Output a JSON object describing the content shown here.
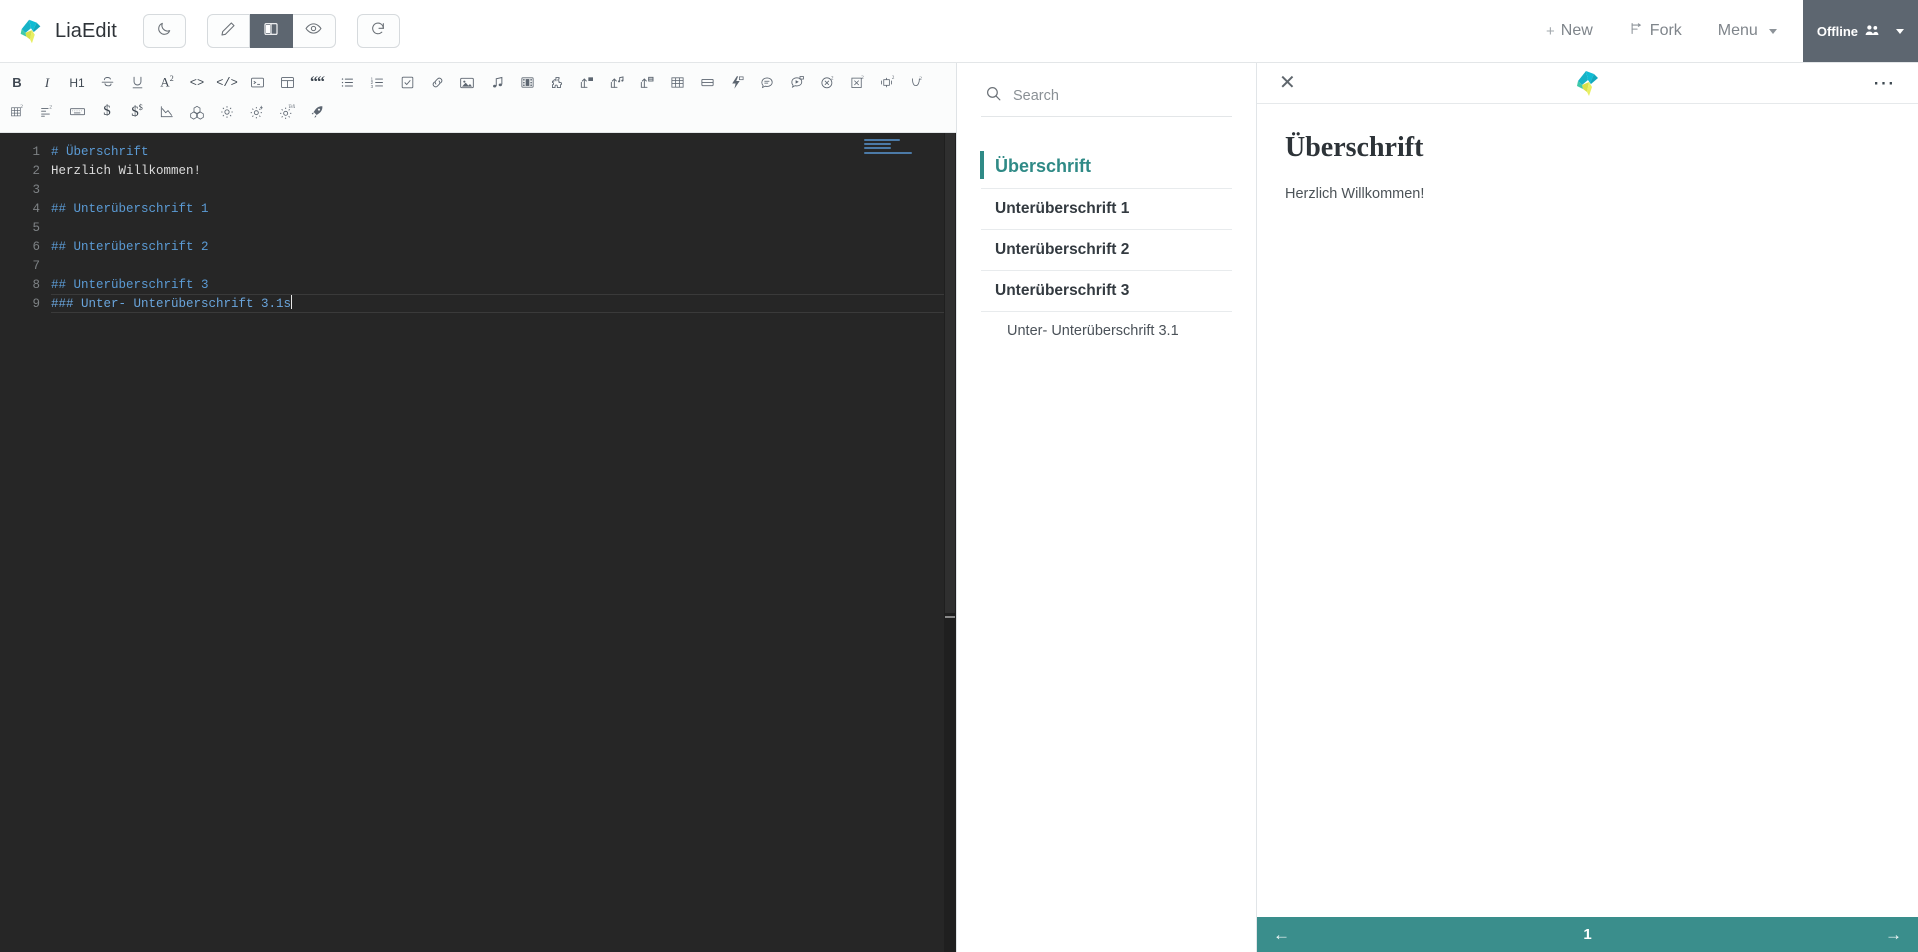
{
  "app": {
    "title": "LiaEdit",
    "logo_icon": "liascript-bird-logo"
  },
  "topbar": {
    "mode_buttons": [
      {
        "name": "dark-mode-toggle",
        "icon": "moon-icon",
        "active": false
      },
      {
        "name": "edit-mode",
        "icon": "pencil-icon",
        "active": false
      },
      {
        "name": "split-mode",
        "icon": "split-view-icon",
        "active": true
      },
      {
        "name": "preview-mode",
        "icon": "eye-icon",
        "active": false
      },
      {
        "name": "reload",
        "icon": "refresh-icon",
        "active": false
      }
    ],
    "new_label": "New",
    "new_icon": "plus-icon",
    "fork_label": "Fork",
    "fork_icon": "fork-icon",
    "menu_label": "Menu",
    "offline_label": "Offline",
    "offline_icon": "users-icon",
    "accent_color": "#5d6670"
  },
  "toolbar": {
    "row1": [
      {
        "name": "bold-button",
        "label": "B",
        "icon": "bold-icon"
      },
      {
        "name": "italic-button",
        "label": "I",
        "icon": "italic-icon"
      },
      {
        "name": "heading-button",
        "label": "H1",
        "icon": "heading-icon"
      },
      {
        "name": "strikethrough-button",
        "label": "S",
        "icon": "strikethrough-icon"
      },
      {
        "name": "underline-button",
        "label": "U",
        "icon": "underline-icon"
      },
      {
        "name": "superscript-button",
        "label": "A2",
        "icon": "superscript-icon"
      },
      {
        "name": "inline-code-button",
        "label": "<>",
        "icon": "inline-code-icon"
      },
      {
        "name": "code-block-button",
        "label": "</>",
        "icon": "code-block-icon"
      },
      {
        "name": "terminal-button",
        "label": "",
        "icon": "terminal-icon"
      },
      {
        "name": "quiz-button",
        "label": "",
        "icon": "quiz-icon"
      },
      {
        "name": "blockquote-button",
        "label": "",
        "icon": "quote-icon"
      },
      {
        "name": "bullet-list-button",
        "label": "",
        "icon": "bullet-list-icon"
      },
      {
        "name": "ordered-list-button",
        "label": "",
        "icon": "ordered-list-icon"
      },
      {
        "name": "task-list-button",
        "label": "",
        "icon": "checkbox-icon"
      },
      {
        "name": "link-button",
        "label": "",
        "icon": "link-icon"
      },
      {
        "name": "image-button",
        "label": "",
        "icon": "image-icon"
      },
      {
        "name": "audio-button",
        "label": "",
        "icon": "music-note-icon"
      },
      {
        "name": "video-button",
        "label": "",
        "icon": "film-icon"
      },
      {
        "name": "embed-button",
        "label": "",
        "icon": "puzzle-icon"
      },
      {
        "name": "upload-image-button",
        "label": "",
        "icon": "upload-image-icon"
      },
      {
        "name": "upload-audio-button",
        "label": "",
        "icon": "upload-audio-icon"
      },
      {
        "name": "upload-file-button",
        "label": "",
        "icon": "upload-file-icon"
      },
      {
        "name": "table-button",
        "label": "",
        "icon": "table-icon"
      },
      {
        "name": "horizontal-rule-button",
        "label": "",
        "icon": "hrule-icon"
      },
      {
        "name": "effect-button",
        "label": "",
        "icon": "lightning-icon"
      },
      {
        "name": "comment-button",
        "label": "",
        "icon": "speech-bubble-icon"
      },
      {
        "name": "animation-button",
        "label": "",
        "icon": "play-bubble-icon"
      },
      {
        "name": "circle-x-button",
        "label": "",
        "icon": "circle-x-icon"
      },
      {
        "name": "square-x-button",
        "label": "",
        "icon": "square-x-icon"
      },
      {
        "name": "gallery-button",
        "label": "",
        "icon": "gallery-icon"
      },
      {
        "name": "curve-button",
        "label": "",
        "icon": "curve-icon"
      }
    ],
    "row2": [
      {
        "name": "grid-quiz-button",
        "label": "",
        "icon": "grid-quiz-icon"
      },
      {
        "name": "survey-button",
        "label": "",
        "icon": "survey-icon"
      },
      {
        "name": "input-field-button",
        "label": "",
        "icon": "keyboard-icon"
      },
      {
        "name": "formula-button",
        "label": "$",
        "icon": "dollar-icon"
      },
      {
        "name": "formula-block-button",
        "label": "$$",
        "icon": "dollar-super-icon"
      },
      {
        "name": "chart-button",
        "label": "",
        "icon": "chart-icon"
      },
      {
        "name": "molecule-button",
        "label": "",
        "icon": "molecule-icon"
      },
      {
        "name": "settings-button",
        "label": "",
        "icon": "gear-icon"
      },
      {
        "name": "settings-effect-button",
        "label": "",
        "icon": "gear-lightning-icon"
      },
      {
        "name": "settings-tex-button",
        "label": "",
        "icon": "gear-tex-icon"
      },
      {
        "name": "rocket-button",
        "label": "",
        "icon": "rocket-icon"
      }
    ]
  },
  "editor": {
    "lines": [
      {
        "num": "1",
        "text": "# Überschrift",
        "kind": "heading"
      },
      {
        "num": "2",
        "text": "Herzlich Willkommen!",
        "kind": "text"
      },
      {
        "num": "3",
        "text": "",
        "kind": "text"
      },
      {
        "num": "4",
        "text": "## Unterüberschrift 1",
        "kind": "heading"
      },
      {
        "num": "5",
        "text": "",
        "kind": "text"
      },
      {
        "num": "6",
        "text": "## Unterüberschrift 2",
        "kind": "heading"
      },
      {
        "num": "7",
        "text": "",
        "kind": "text"
      },
      {
        "num": "8",
        "text": "## Unterüberschrift 3",
        "kind": "heading"
      },
      {
        "num": "9",
        "text": "### Unter- Unterüberschrift 3.1s",
        "kind": "heading-active"
      }
    ]
  },
  "toc": {
    "search_placeholder": "Search",
    "search_value": "",
    "search_icon": "search-icon",
    "items": [
      {
        "label": "Überschrift",
        "level": 1
      },
      {
        "label": "Unterüberschrift 1",
        "level": 2
      },
      {
        "label": "Unterüberschrift 2",
        "level": 2
      },
      {
        "label": "Unterüberschrift 3",
        "level": 2
      },
      {
        "label": "Unter- Unterüberschrift 3.1",
        "level": 3
      }
    ],
    "accent_color": "#2f8a86"
  },
  "preview": {
    "close_icon": "close-icon",
    "logo_icon": "liascript-bird-logo",
    "menu_icon": "more-options-icon",
    "heading": "Überschrift",
    "paragraph": "Herzlich Willkommen!",
    "nav": {
      "prev_icon": "arrow-left-icon",
      "prev_label": "←",
      "page": "1",
      "next_icon": "arrow-right-icon",
      "next_label": "→",
      "bar_color": "#3a8e8c"
    }
  }
}
